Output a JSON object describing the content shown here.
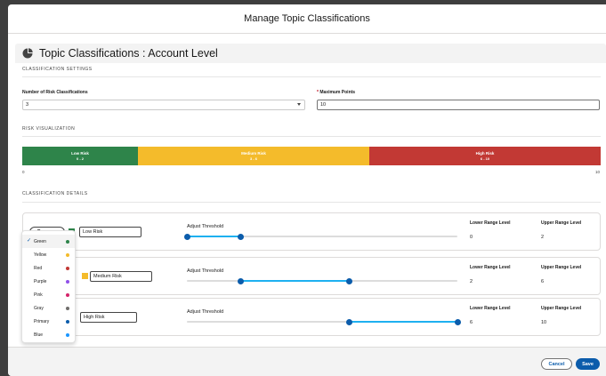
{
  "modal": {
    "title": "Manage Topic Classifications"
  },
  "card": {
    "title": "Topic Classifications : Account Level",
    "icon": "pie-chart-icon"
  },
  "settings": {
    "section_title": "CLASSIFICATION SETTINGS",
    "num_label": "Number of Risk Classifications",
    "num_value": "3",
    "max_required": "*",
    "max_label": "Maximum Points",
    "max_value": "10"
  },
  "visualization": {
    "section_title": "RISK VISUALIZATION",
    "segments": [
      {
        "name": "Low Risk",
        "range": "0 - 2",
        "color": "#2e844a",
        "fraction": 0.2
      },
      {
        "name": "Medium Risk",
        "range": "3 - 6",
        "color": "#f4bb2b",
        "fraction": 0.4
      },
      {
        "name": "High Risk",
        "range": "6 - 10",
        "color": "#c23934",
        "fraction": 0.4
      }
    ],
    "axis_min": "0",
    "axis_max": "10"
  },
  "details": {
    "section_title": "CLASSIFICATION DETAILS",
    "adjust_label": "Adjust Threshold",
    "lower_label": "Lower Range Level",
    "upper_label": "Upper Range Level",
    "rows": [
      {
        "color_label": "Green",
        "swatch": "#2e844a",
        "name": "Low Risk",
        "lower": "0",
        "upper": "2",
        "slider_min": 0.0,
        "slider_max": 0.2
      },
      {
        "color_label": "",
        "swatch": "#f4bb2b",
        "name": "Medium Risk",
        "lower": "2",
        "upper": "6",
        "slider_min": 0.2,
        "slider_max": 0.6
      },
      {
        "color_label": "",
        "swatch": "",
        "name": "High Risk",
        "lower": "6",
        "upper": "10",
        "slider_min": 0.6,
        "slider_max": 1.0
      }
    ]
  },
  "dropdown": {
    "options": [
      {
        "label": "Green",
        "color": "#2e844a",
        "selected": true
      },
      {
        "label": "Yellow",
        "color": "#f4bb2b",
        "selected": false
      },
      {
        "label": "Red",
        "color": "#c23934",
        "selected": false
      },
      {
        "label": "Purple",
        "color": "#9050e9",
        "selected": false
      },
      {
        "label": "Pink",
        "color": "#d4246a",
        "selected": false
      },
      {
        "label": "Gray",
        "color": "#706e6b",
        "selected": false
      },
      {
        "label": "Primary",
        "color": "#0b5cab",
        "selected": false
      },
      {
        "label": "Blue",
        "color": "#1b96ff",
        "selected": false
      }
    ]
  },
  "footer": {
    "cancel": "Cancel",
    "save": "Save"
  }
}
